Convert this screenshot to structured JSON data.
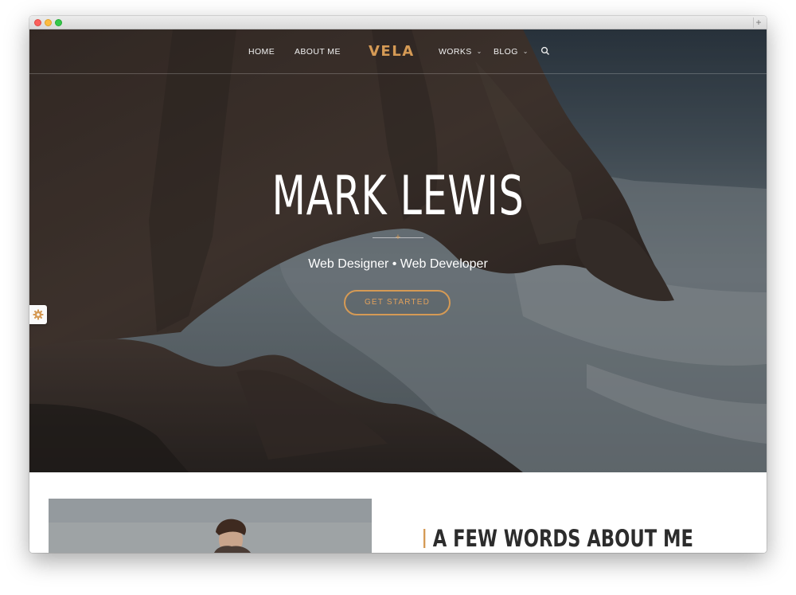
{
  "nav": {
    "home": "HOME",
    "about": "ABOUT ME",
    "logo": "VELA",
    "works": "WORKS",
    "blog": "BLOG"
  },
  "icons": {
    "search": "search-icon",
    "chevron": "chevron-down-icon",
    "settings": "gear-icon"
  },
  "hero": {
    "title": "MARK LEWIS",
    "subtitle": "Web Designer • Web Developer",
    "cta_label": "GET STARTED"
  },
  "about": {
    "heading": "A FEW WORDS ABOUT ME"
  },
  "colors": {
    "accent": "#d59a55",
    "text_dark": "#2c2c2c"
  }
}
